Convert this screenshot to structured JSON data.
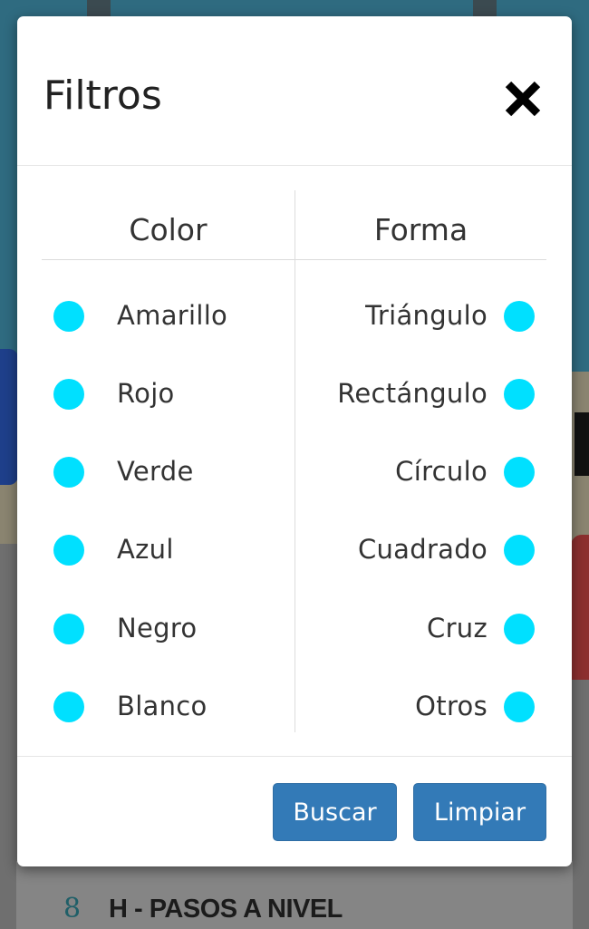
{
  "background": {
    "number": "8",
    "heading": "H - PASOS A NIVEL"
  },
  "modal": {
    "title": "Filtros",
    "close_icon": "close-icon",
    "columns": {
      "color": {
        "header": "Color",
        "options": [
          "Amarillo",
          "Rojo",
          "Verde",
          "Azul",
          "Negro",
          "Blanco"
        ]
      },
      "shape": {
        "header": "Forma",
        "options": [
          "Triángulo",
          "Rectángulo",
          "Círculo",
          "Cuadrado",
          "Cruz",
          "Otros"
        ]
      }
    },
    "buttons": {
      "search": "Buscar",
      "clear": "Limpiar"
    }
  },
  "colors": {
    "toggle_dot": "#00e0ff",
    "primary_button": "#337ab7",
    "overlay_bg": "#5a6b73"
  }
}
